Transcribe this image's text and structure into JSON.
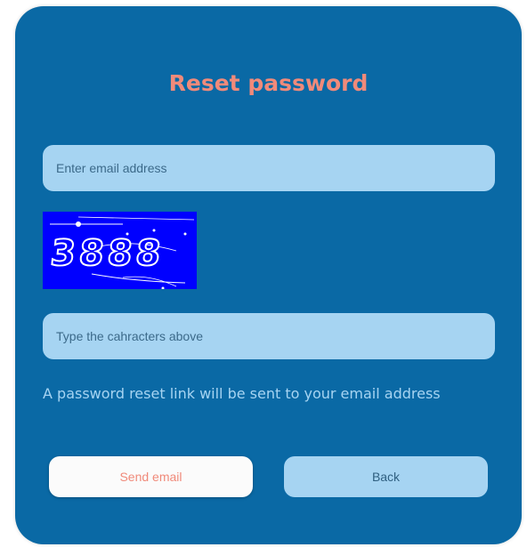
{
  "form": {
    "title": "Reset password",
    "email_placeholder": "Enter email address",
    "captcha_text": "3888",
    "captcha_placeholder": "Type the cahracters above",
    "info_text": "A password reset link will be sent to your email address",
    "send_label": "Send email",
    "back_label": "Back"
  },
  "colors": {
    "card_background": "#0a69a5",
    "title": "#f08a7a",
    "field_background": "#a6d4f2",
    "captcha_background": "#0000ff"
  }
}
